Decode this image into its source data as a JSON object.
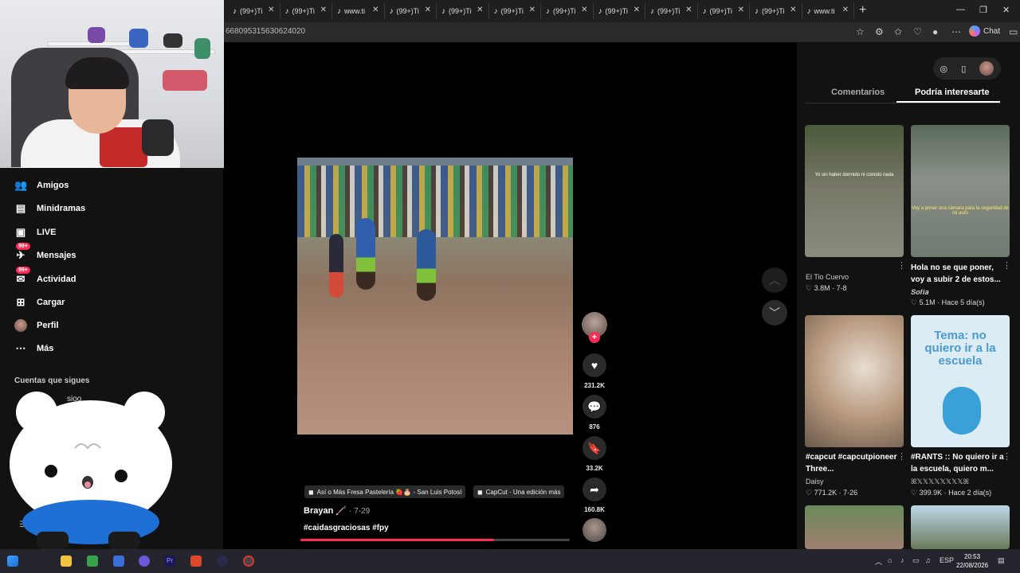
{
  "browser": {
    "tabs": [
      {
        "icon": "tiktok",
        "label": "(99+)Ti"
      },
      {
        "icon": "tiktok",
        "label": "(99+)Ti"
      },
      {
        "icon": "tiktok",
        "label": "www.ti"
      },
      {
        "icon": "tiktok",
        "label": "(99+)Ti"
      },
      {
        "icon": "tiktok",
        "label": "(99+)Ti"
      },
      {
        "icon": "tiktok",
        "label": "(99+)Ti"
      },
      {
        "icon": "tiktok",
        "label": "(99+)Ti"
      },
      {
        "icon": "tiktok",
        "label": "(99+)Ti"
      },
      {
        "icon": "tiktok",
        "label": "(99+)Ti"
      },
      {
        "icon": "tiktok",
        "label": "(99+)Ti"
      },
      {
        "icon": "tiktok",
        "label": "(99+)Ti"
      },
      {
        "icon": "tiktok",
        "label": "www.ti"
      }
    ],
    "url": "668095315630624020",
    "chat_label": "Chat"
  },
  "sidebar": {
    "items": [
      {
        "icon": "friends-icon",
        "label": "Amigos"
      },
      {
        "icon": "minidramas-icon",
        "label": "Minidramas"
      },
      {
        "icon": "live-icon",
        "label": "LIVE"
      },
      {
        "icon": "messages-icon",
        "label": "Mensajes",
        "badge": "99+"
      },
      {
        "icon": "activity-icon",
        "label": "Actividad",
        "badge": "99+"
      },
      {
        "icon": "upload-icon",
        "label": "Cargar"
      },
      {
        "icon": "profile-icon",
        "label": "Perfil"
      },
      {
        "icon": "more-icon",
        "label": "Más"
      }
    ],
    "following_title": "Cuentas que sigues",
    "following_name": "sioo",
    "following_sub": "o"
  },
  "video": {
    "actions": {
      "likes": "231.2K",
      "comments": "876",
      "saves": "33.2K",
      "shares": "160.8K"
    },
    "chips": [
      "Así o Más Fresa Pastelería 🍓🎂 - San Luis Potosí",
      "CapCut · Una edición más"
    ],
    "author": "Brayan 🦯",
    "date": "· 7-29",
    "caption": "#caidasgraciosas #fpy",
    "progress": 0.72
  },
  "right_panel": {
    "tabs": [
      "Comentarios",
      "Podría interesarte"
    ],
    "active_tab": "Podría interesarte",
    "cards": [
      {
        "title": "",
        "author": "El Tio Cuervo",
        "likes": "3.8M",
        "date": "7-8",
        "thumb_text": "Yo sin haber dormido ni comido nada"
      },
      {
        "title": "Hola no se que poner, voy a subir 2 de estos...",
        "author": "𝑺𝒐𝒇𝒊𝒂",
        "likes": "5.1M",
        "date": "Hace 5 día(s)",
        "thumb_text": "Voy a poner una cámara para la seguridad de mi auto"
      },
      {
        "title": "#capcut #capcutpioneer Three...",
        "author": "Daisy",
        "likes": "771.2K",
        "date": "7-26",
        "thumb_text": ""
      },
      {
        "title": "#RANTS :: No quiero ir a la escuela, quiero m...",
        "author": "ꕤ𝕏𝕏𝕏𝕏𝕏𝕏𝕏𝕏ꕤ",
        "likes": "399.9K",
        "date": "Hace 2 día(s)",
        "thumb_text": "Tema: no quiero ir a la escuela"
      }
    ]
  },
  "taskbar": {
    "lang": "ESP",
    "time": "20:53",
    "date": "22/08/2026"
  },
  "colors": {
    "accent": "#fe2c55",
    "background": "#121212"
  }
}
